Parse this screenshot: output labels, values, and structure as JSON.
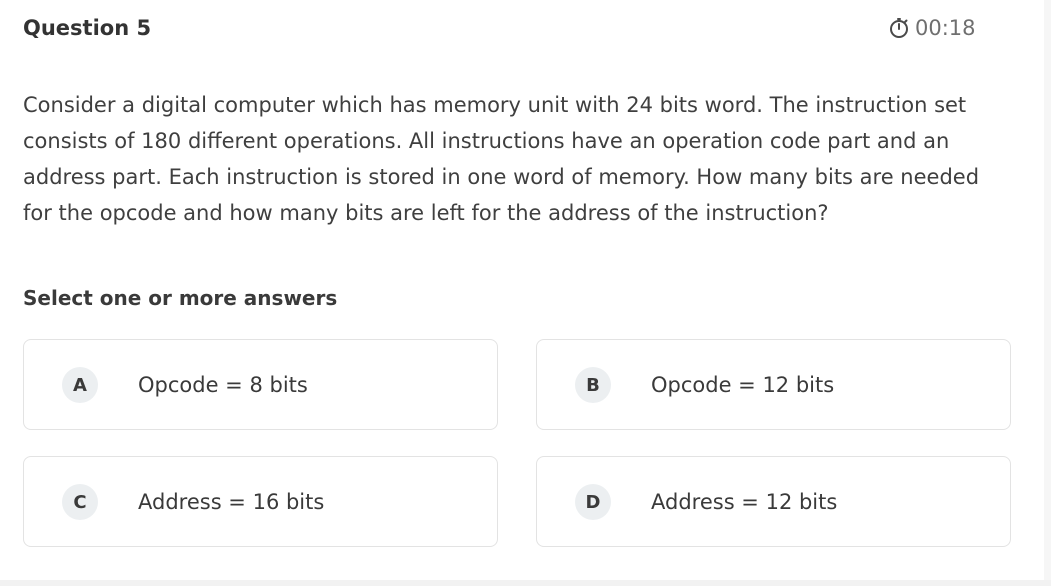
{
  "header": {
    "question_number": "Question 5",
    "timer_icon": "stopwatch-icon",
    "timer_value": "00:18"
  },
  "question": {
    "text": "Consider a digital computer which has memory unit with 24 bits word. The instruction set consists of 180 different operations. All instructions have an operation code part and an address part. Each instruction is stored in one word of memory. How many bits are needed for the opcode and how many bits are left for the address of the instruction?"
  },
  "instructions": {
    "select_label": "Select one or more answers"
  },
  "options": [
    {
      "letter": "A",
      "text": "Opcode = 8 bits"
    },
    {
      "letter": "B",
      "text": "Opcode = 12 bits"
    },
    {
      "letter": "C",
      "text": "Address = 16 bits"
    },
    {
      "letter": "D",
      "text": "Address = 12 bits"
    }
  ],
  "colors": {
    "badge_bg": "#eceff1",
    "border": "#e3e3e3",
    "text": "#3a3a3a",
    "timer": "#6f6f6f"
  }
}
